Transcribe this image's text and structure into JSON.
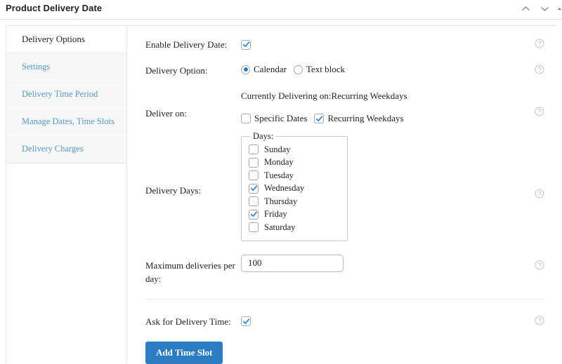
{
  "window": {
    "title": "Product Delivery Date",
    "controls": [
      {
        "name": "collapse-up-button",
        "icon": "chevron-up-icon"
      },
      {
        "name": "expand-down-button",
        "icon": "chevron-down-icon"
      },
      {
        "name": "edge-marker",
        "icon": "triangle-icon"
      }
    ]
  },
  "sidebar": {
    "heading": "Delivery Options",
    "items": [
      {
        "label": "Settings"
      },
      {
        "label": "Delivery Time Period"
      },
      {
        "label": "Manage Dates, Time Slots"
      },
      {
        "label": "Delivery Charges"
      }
    ]
  },
  "form": {
    "enable_delivery_date": {
      "label": "Enable Delivery Date:",
      "checked": true
    },
    "delivery_option": {
      "label": "Delivery Option:",
      "options": [
        {
          "label": "Calendar",
          "selected": true
        },
        {
          "label": "Text block",
          "selected": false
        }
      ]
    },
    "deliver_on": {
      "label": "Deliver on:",
      "status": "Currently Delivering on:Recurring Weekdays",
      "options": [
        {
          "label": "Specific Dates",
          "checked": false
        },
        {
          "label": "Recurring Weekdays",
          "checked": true
        }
      ]
    },
    "delivery_days": {
      "label": "Delivery Days:",
      "legend": "Days:",
      "days": [
        {
          "label": "Sunday",
          "checked": false
        },
        {
          "label": "Monday",
          "checked": false
        },
        {
          "label": "Tuesday",
          "checked": false
        },
        {
          "label": "Wednesday",
          "checked": true
        },
        {
          "label": "Thursday",
          "checked": false
        },
        {
          "label": "Friday",
          "checked": true
        },
        {
          "label": "Saturday",
          "checked": false
        }
      ]
    },
    "max_deliveries": {
      "label": "Maximum deliveries per day:",
      "value": "100",
      "placeholder": ""
    },
    "ask_delivery_time": {
      "label": "Ask for Delivery Time:",
      "checked": true
    },
    "add_time_slot_button": "Add Time Slot",
    "help_icon": "help-circle-icon"
  },
  "colors": {
    "accent_blue": "#2b7cc0",
    "link_blue": "#5596c8",
    "check_blue": "#3d8fd6",
    "sidebar_bg": "#f7f7f7",
    "border": "#e4e4e4"
  }
}
